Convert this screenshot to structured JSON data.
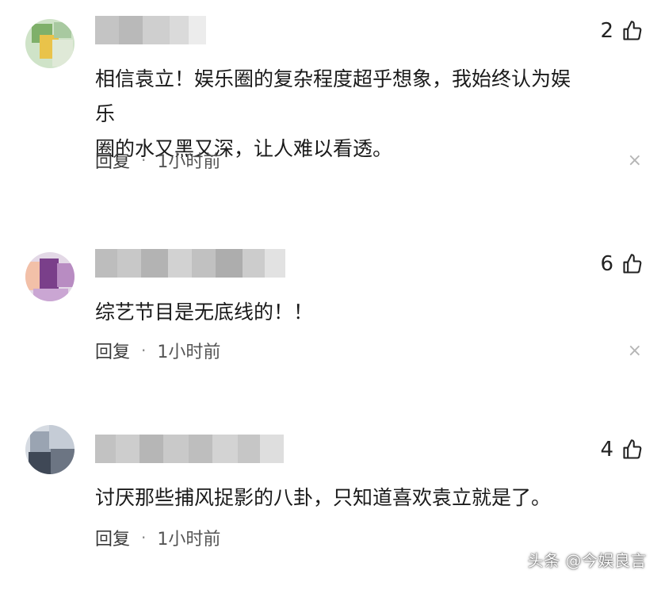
{
  "comments": [
    {
      "likes": "2",
      "text": "相信袁立！娱乐圈的复杂程度超乎想象，我始终认为娱乐\n圈的水又黑又深，让人难以看透。",
      "reply_label": "回复",
      "separator": "·",
      "time": "1小时前",
      "close_glyph": "×"
    },
    {
      "likes": "6",
      "text": "综艺节目是无底线的！！",
      "reply_label": "回复",
      "separator": "·",
      "time": "1小时前",
      "close_glyph": "×"
    },
    {
      "likes": "4",
      "text": "讨厌那些捕风捉影的八卦，只知道喜欢袁立就是了。",
      "reply_label": "回复",
      "separator": "·",
      "time": "1小时前",
      "close_glyph": "×"
    }
  ],
  "watermark": "头条 @今娱良言",
  "icons": {
    "like": "thumbs-up-icon",
    "close": "close-icon"
  },
  "colors": {
    "background": "#ffffff",
    "text": "#1a1a1a",
    "muted": "#555555",
    "close": "#b5b5b5"
  }
}
